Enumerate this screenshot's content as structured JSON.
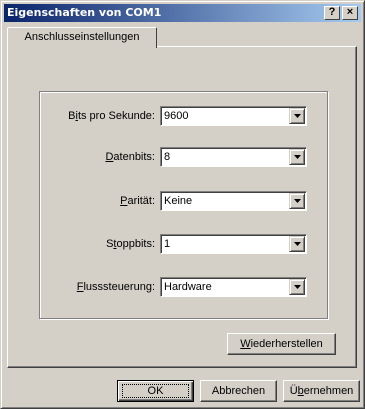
{
  "window": {
    "title": "Eigenschaften von COM1",
    "help_glyph": "?",
    "close_glyph": "×"
  },
  "tab": {
    "label": "Anschlusseinstellungen"
  },
  "fields": [
    {
      "key_before": "B",
      "key": "i",
      "key_after": "ts pro Sekunde:",
      "value": "9600"
    },
    {
      "key_before": "",
      "key": "D",
      "key_after": "atenbits:",
      "value": "8"
    },
    {
      "key_before": "",
      "key": "P",
      "key_after": "arität:",
      "value": "Keine"
    },
    {
      "key_before": "S",
      "key": "t",
      "key_after": "oppbits:",
      "value": "1"
    },
    {
      "key_before": "",
      "key": "F",
      "key_after": "lusssteuerung:",
      "value": "Hardware"
    }
  ],
  "buttons": {
    "restore": {
      "key": "W",
      "rest": "iederherstellen"
    },
    "ok": "OK",
    "cancel": "Abbrechen",
    "apply": {
      "before": "Ü",
      "key": "b",
      "rest": "ernehmen"
    }
  },
  "colors": {
    "face": "#d4d0c8",
    "title_start": "#0a246a",
    "title_end": "#a6caf0"
  },
  "icons": {
    "dropdown": "chevron-down-icon"
  }
}
